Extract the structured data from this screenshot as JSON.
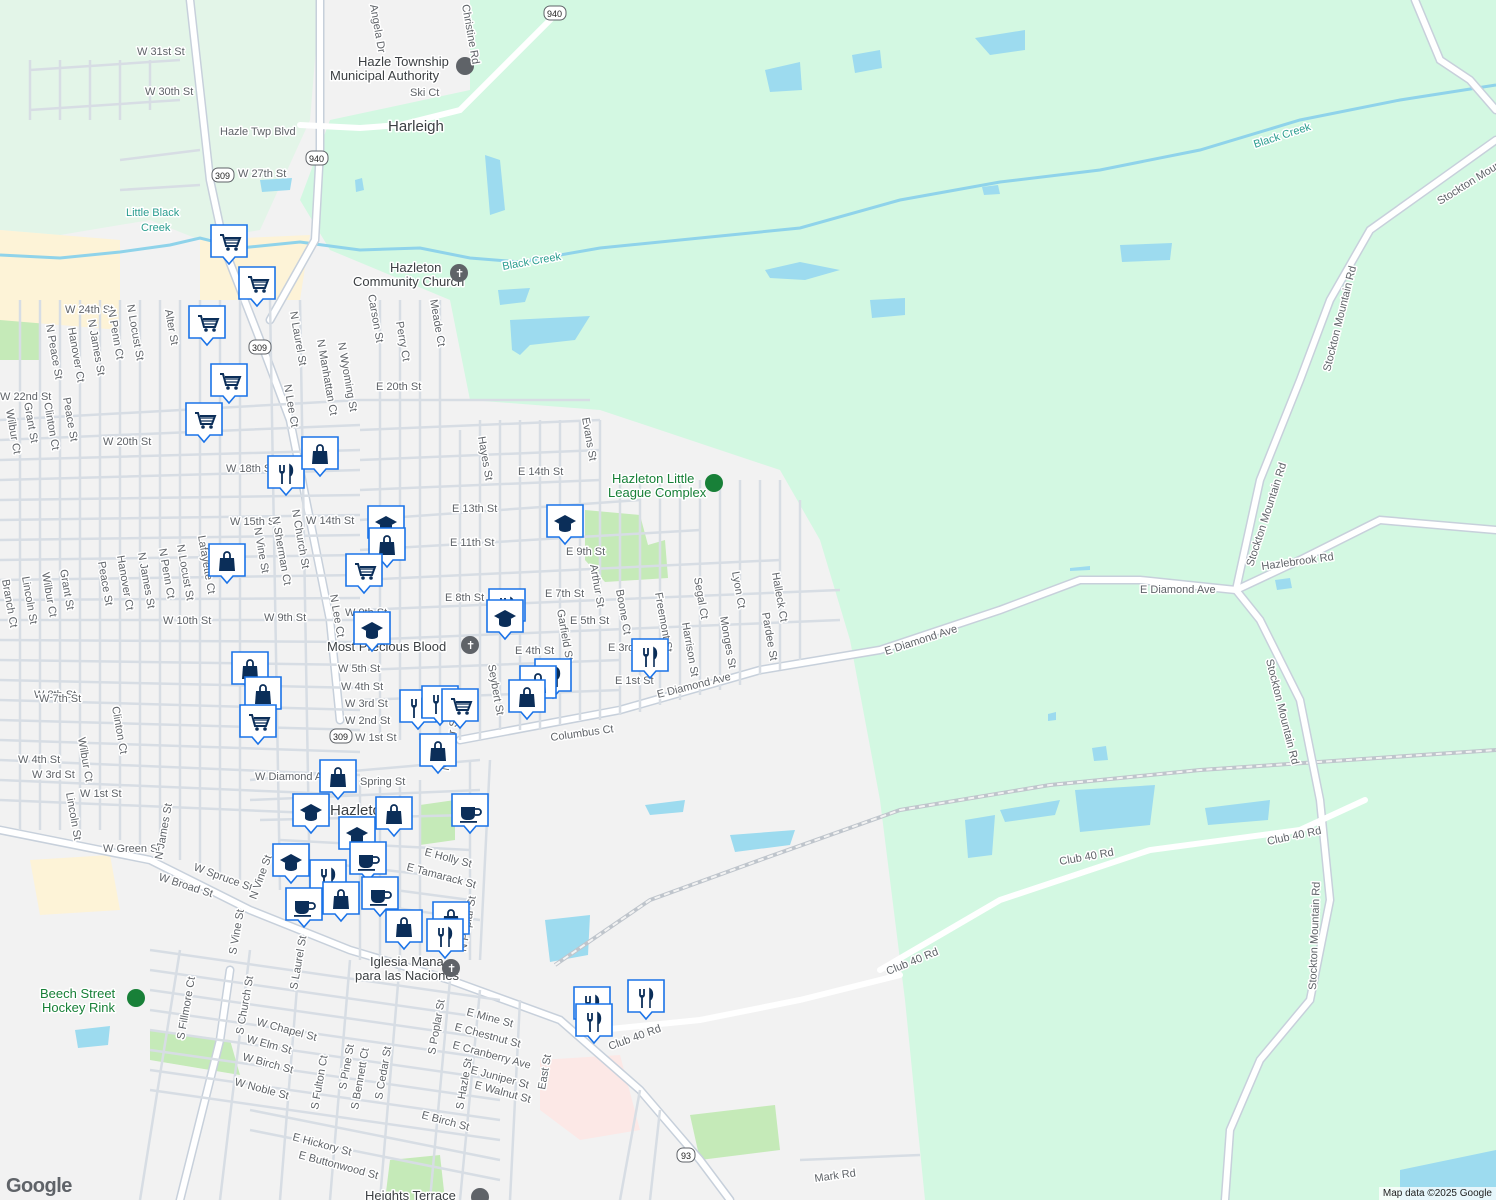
{
  "map": {
    "towns": [
      "Harleigh",
      "Hazleton"
    ],
    "water_labels": [
      "Black Creek",
      "Black Creek",
      "Little Black",
      "Creek"
    ],
    "pois": [
      {
        "line1": "Hazle Township",
        "line2": "Municipal Authority",
        "icon": "government-icon"
      },
      {
        "line1": "Hazleton",
        "line2": "Community Church",
        "icon": "church-icon"
      },
      {
        "line1": "Hazleton Little",
        "line2": "League Complex",
        "icon": "park-icon"
      },
      {
        "line1": "Most Precious Blood",
        "line2": "",
        "icon": "church-icon"
      },
      {
        "line1": "Iglesia Mana",
        "line2": "para las Naciones",
        "icon": "church-icon"
      },
      {
        "line1": "Beech Street",
        "line2": "Hockey Rink",
        "icon": "park-icon"
      },
      {
        "line1": "Heights Terrace",
        "line2": "",
        "icon": "church-icon"
      }
    ],
    "streets": [
      "W 31st St",
      "W 30th St",
      "Ski Ct",
      "Hazle Twp Blvd",
      "W 27th St",
      "Angela Dr",
      "Christine Rd",
      "W 24th St",
      "N Locust St",
      "N Penn Ct",
      "N James St",
      "Hanover Ct",
      "N Peace St",
      "Alter St",
      "Carson St",
      "Perry Ct",
      "Meade Ct",
      "E 20th St",
      "W 22nd St",
      "Grant St",
      "Clinton Ct",
      "Peace St",
      "Wilbur Ct",
      "W 20th St",
      "W 18th St",
      "N Laurel St",
      "N Lee Ct",
      "N Manhattan Ct",
      "N Wyoming St",
      "Hayes St",
      "Evans St",
      "E 14th St",
      "E 13th St",
      "E 11th St",
      "E 9th St",
      "W 15th St",
      "W 14th St",
      "N Church St",
      "N Sherman Ct",
      "N Vine St",
      "Lafayette Ct",
      "N Locust St",
      "N Penn Ct",
      "N James St",
      "Hanover Ct",
      "Peace St",
      "Grant St",
      "Wilbur Ct",
      "Lincoln St",
      "Branch Ct",
      "W 10th St",
      "W 9th St",
      "N Lee Ct",
      "E 8th St",
      "E 7th St",
      "E 5th St",
      "E 4th St",
      "E 3rd St",
      "E 1st St",
      "Arthur St",
      "Garfield St",
      "Boone Ct",
      "Freemont St",
      "Harrison St",
      "Segal Ct",
      "Monges St",
      "Lyon Ct",
      "Pardee St",
      "Halleck Ct",
      "Seybert St",
      "N Cedar St",
      "Columbus Ct",
      "E Diamond Ave",
      "W 9th St",
      "W 8th St",
      "W 7th St",
      "W 5th St",
      "W 4th St",
      "W 3rd St",
      "W 2nd St",
      "W 1st St",
      "Clinton Ct",
      "Wilbur Ct",
      "Lincoln St",
      "W Diamond Ave",
      "W 4th St",
      "W 3rd St",
      "W 1st St",
      "Spring St",
      "W Green St",
      "N James St",
      "W Spruce St",
      "N Vine St",
      "W Broad St",
      "S Vine St",
      "E Holly St",
      "E Tamarack St",
      "N Poplar St",
      "S Church St",
      "S Laurel St",
      "S Fillmore Ct",
      "W Chapel St",
      "W Elm St",
      "W Birch St",
      "W Noble St",
      "S Fulton Ct",
      "S Pine St",
      "S Bennett Ct",
      "S Cedar St",
      "S Poplar St",
      "S Hazle St",
      "E Mine St",
      "E Chestnut St",
      "E Cranberry Ave",
      "E Juniper St",
      "E Walnut St",
      "East St",
      "E Birch St",
      "E Hickory St",
      "E Buttonwood St",
      "Club 40 Rd",
      "Mark Rd",
      "Stockton Mountain Rd",
      "Hazlebrook Rd",
      "Stockton Mountain Rd",
      "Stockton Mountain Rd",
      "Stockton Mountain Rd",
      "Club 40 Rd",
      "Club 40 Rd",
      "E Diamond Ave",
      "E Diamond Ave",
      "Club 40 Rd",
      "Stockton Mountain Rd"
    ],
    "highway_shields": [
      "940",
      "940",
      "309",
      "309",
      "309",
      "93"
    ],
    "attribution": "Map data ©2025 Google",
    "logo": "Google",
    "colors": {
      "forest": "#d3f8e2",
      "urban": "#f2f2f2",
      "water": "#9ddbef",
      "road": "#ffffff",
      "road_outline": "#c7d0db",
      "marker_bg": "#ffffff",
      "marker_border": "#1a73e8",
      "marker_icon": "#0b2e59",
      "park": "#c5eab8"
    },
    "markers": [
      {
        "type": "shopping-cart-icon"
      },
      {
        "type": "shopping-cart-icon"
      },
      {
        "type": "shopping-cart-icon"
      },
      {
        "type": "shopping-cart-icon"
      },
      {
        "type": "shopping-cart-icon"
      },
      {
        "type": "restaurant-icon"
      },
      {
        "type": "shopping-bag-icon"
      },
      {
        "type": "shopping-bag-icon"
      },
      {
        "type": "school-icon"
      },
      {
        "type": "shopping-bag-icon"
      },
      {
        "type": "shopping-cart-icon"
      },
      {
        "type": "school-icon"
      },
      {
        "type": "school-icon"
      },
      {
        "type": "restaurant-icon"
      },
      {
        "type": "school-icon"
      },
      {
        "type": "restaurant-icon"
      },
      {
        "type": "shopping-bag-icon"
      },
      {
        "type": "restaurant-icon"
      },
      {
        "type": "shopping-bag-icon"
      },
      {
        "type": "shopping-bag-icon"
      },
      {
        "type": "shopping-bag-icon"
      },
      {
        "type": "shopping-cart-icon"
      },
      {
        "type": "restaurant-icon"
      },
      {
        "type": "restaurant-icon"
      },
      {
        "type": "shopping-cart-icon"
      },
      {
        "type": "shopping-bag-icon"
      },
      {
        "type": "shopping-bag-icon"
      },
      {
        "type": "coffee-icon"
      },
      {
        "type": "school-icon"
      },
      {
        "type": "shopping-bag-icon"
      },
      {
        "type": "school-icon"
      },
      {
        "type": "coffee-icon"
      },
      {
        "type": "school-icon"
      },
      {
        "type": "restaurant-icon"
      },
      {
        "type": "shopping-bag-icon"
      },
      {
        "type": "coffee-icon"
      },
      {
        "type": "coffee-icon"
      },
      {
        "type": "shopping-bag-icon"
      },
      {
        "type": "shopping-bag-icon"
      },
      {
        "type": "restaurant-icon"
      },
      {
        "type": "restaurant-icon"
      },
      {
        "type": "restaurant-icon"
      },
      {
        "type": "restaurant-icon"
      }
    ]
  }
}
